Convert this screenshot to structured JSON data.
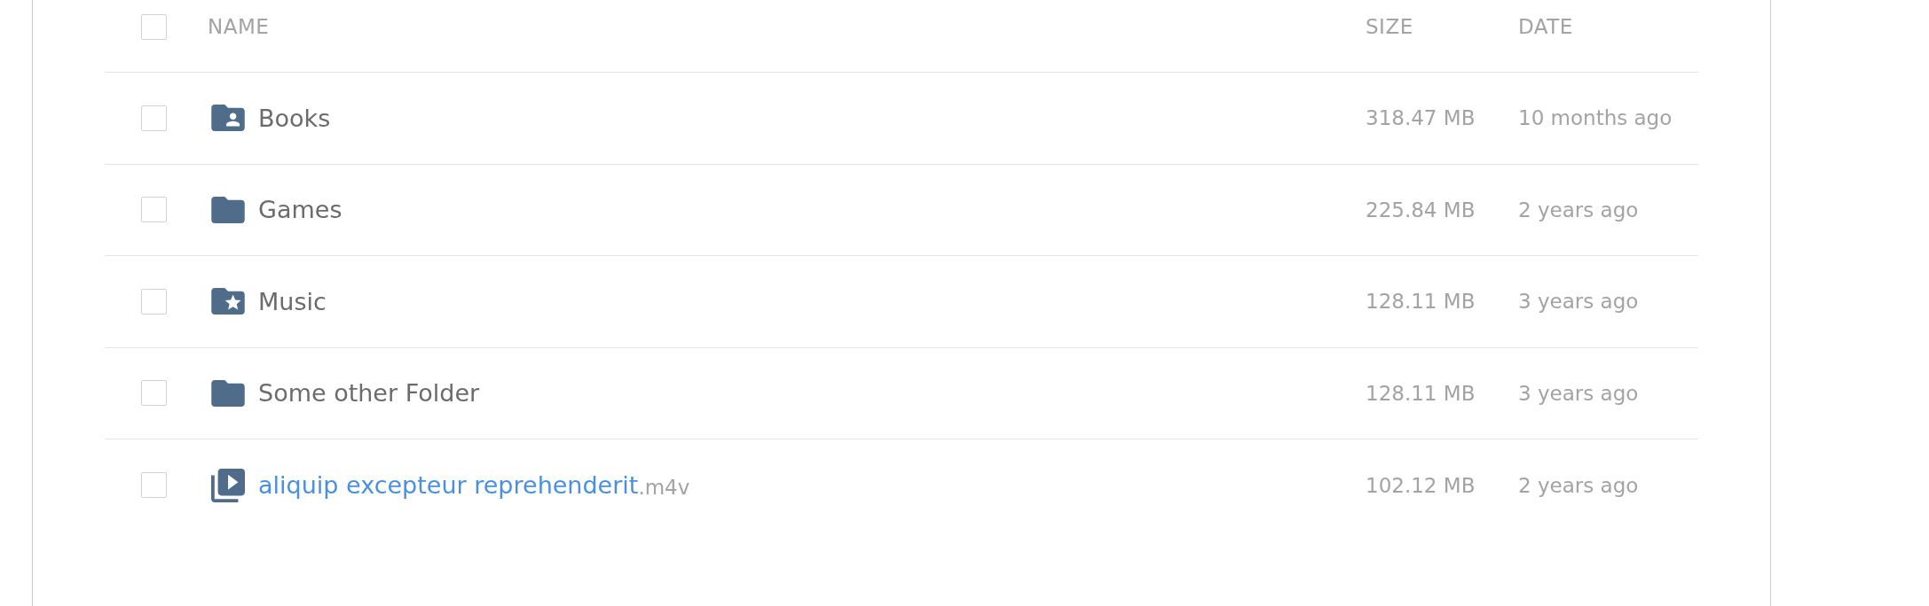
{
  "table": {
    "select_all": {
      "checked": false
    },
    "columns": [
      {
        "label": "NAME"
      },
      {
        "label": "SIZE"
      },
      {
        "label": "DATE"
      }
    ],
    "rows": [
      {
        "kind": "shared-folder",
        "name": "Books",
        "size": "318.47 MB",
        "date": "10 months ago",
        "checked": false
      },
      {
        "kind": "folder",
        "name": "Games",
        "size": "225.84 MB",
        "date": "2 years ago",
        "checked": false
      },
      {
        "kind": "starred-folder",
        "name": "Music",
        "size": "128.11 MB",
        "date": "3 years ago",
        "checked": false
      },
      {
        "kind": "folder",
        "name": "Some other Folder",
        "size": "128.11 MB",
        "date": "3 years ago",
        "checked": false
      },
      {
        "kind": "video-file",
        "name": "aliquip excepteur reprehenderit",
        "extension": ".m4v",
        "size": "102.12 MB",
        "date": "2 years ago",
        "checked": false
      }
    ]
  }
}
